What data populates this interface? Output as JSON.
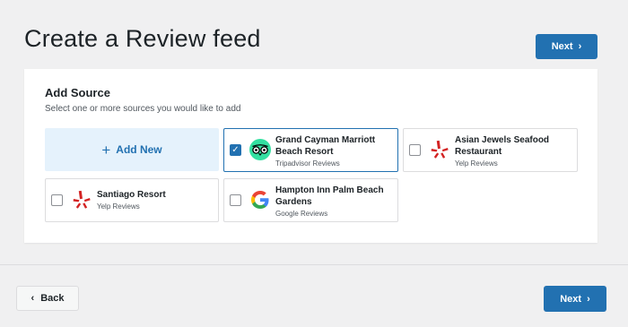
{
  "header": {
    "title": "Create a Review feed",
    "next_label": "Next"
  },
  "card": {
    "title": "Add Source",
    "subtitle": "Select one or more sources you would like to add",
    "add_new_label": "Add New",
    "sources": [
      {
        "name": "Grand Cayman Marriott Beach Resort",
        "type": "Tripadvisor Reviews",
        "checked": true,
        "icon": "tripadvisor-icon"
      },
      {
        "name": "Asian Jewels Seafood Restaurant",
        "type": "Yelp Reviews",
        "checked": false,
        "icon": "yelp-icon"
      },
      {
        "name": "Santiago Resort",
        "type": "Yelp Reviews",
        "checked": false,
        "icon": "yelp-icon"
      },
      {
        "name": "Hampton Inn Palm Beach Gardens",
        "type": "Google Reviews",
        "checked": false,
        "icon": "google-icon"
      }
    ]
  },
  "footer": {
    "back_label": "Back",
    "next_label": "Next"
  },
  "colors": {
    "primary": "#2271b1",
    "tripadvisor": "#34e0a1",
    "yelp": "#d32323"
  }
}
